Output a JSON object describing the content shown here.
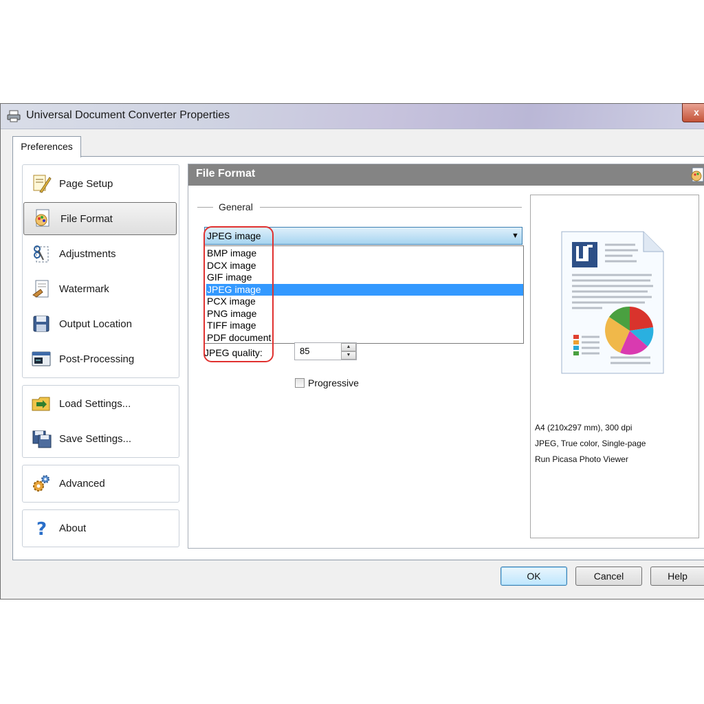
{
  "window": {
    "title": "Universal Document Converter Properties",
    "close_glyph": "x"
  },
  "tabs": [
    {
      "label": "Preferences"
    }
  ],
  "sidebar": {
    "group1": [
      {
        "label": "Page Setup",
        "icon": "page-setup-icon"
      },
      {
        "label": "File Format",
        "icon": "file-format-icon",
        "active": true
      },
      {
        "label": "Adjustments",
        "icon": "adjustments-icon"
      },
      {
        "label": "Watermark",
        "icon": "watermark-icon"
      },
      {
        "label": "Output Location",
        "icon": "output-location-icon"
      },
      {
        "label": "Post-Processing",
        "icon": "post-processing-icon"
      }
    ],
    "group2": [
      {
        "label": "Load Settings...",
        "icon": "load-settings-icon"
      },
      {
        "label": "Save Settings...",
        "icon": "save-settings-icon"
      }
    ],
    "group3": [
      {
        "label": "Advanced",
        "icon": "gears-icon"
      }
    ],
    "group4": [
      {
        "label": "About",
        "icon": "help-icon"
      }
    ]
  },
  "main": {
    "header_title": "File Format",
    "section_label": "General",
    "format_select": {
      "value": "JPEG image",
      "options": [
        "BMP image",
        "DCX image",
        "GIF image",
        "JPEG image",
        "PCX image",
        "PNG image",
        "TIFF image",
        "PDF document"
      ],
      "highlighted": "JPEG image"
    },
    "quality_label": "JPEG quality:",
    "quality_value": "85",
    "progressive_label": "Progressive",
    "progressive_checked": false
  },
  "preview": {
    "info_lines": [
      "A4 (210x297 mm), 300 dpi",
      "JPEG, True color, Single-page",
      "Run Picasa Photo Viewer"
    ]
  },
  "buttons": {
    "ok": "OK",
    "cancel": "Cancel",
    "help": "Help"
  },
  "colors": {
    "accent": "#3399ff",
    "header_bg": "#848484",
    "highlight_outline": "#e0312f"
  }
}
